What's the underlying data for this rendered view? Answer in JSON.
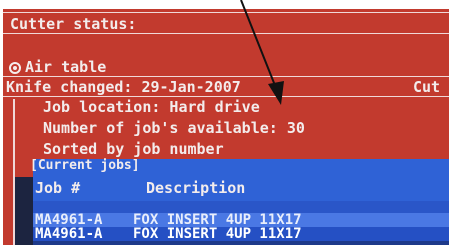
{
  "header": {
    "cutter_status": "Cutter status:"
  },
  "options": {
    "air_table": "Air table"
  },
  "status_bar": {
    "knife_changed": "Knife changed: 29-Jan-2007",
    "cut_label": "Cut"
  },
  "info": {
    "job_location": "Job location: Hard drive",
    "jobs_available": "Number of job's available: 30",
    "sorted_by": "Sorted by job number"
  },
  "jobs": {
    "panel_title": "[Current jobs]",
    "col_job": "Job #",
    "col_description": "Description",
    "rows": [
      {
        "job": "MA4961-A",
        "description": "FOX INSERT 4UP 11X17"
      },
      {
        "job": "MA4961-A",
        "description": "FOX INSERT 4UP 11X17"
      }
    ]
  },
  "colors": {
    "screen_bg": "#c23a2e",
    "panel_blue": "#2a56c8",
    "text": "#f3ecec"
  },
  "icons": {
    "radio": "radio-selected-icon",
    "arrow": "pointer-arrow-icon"
  }
}
